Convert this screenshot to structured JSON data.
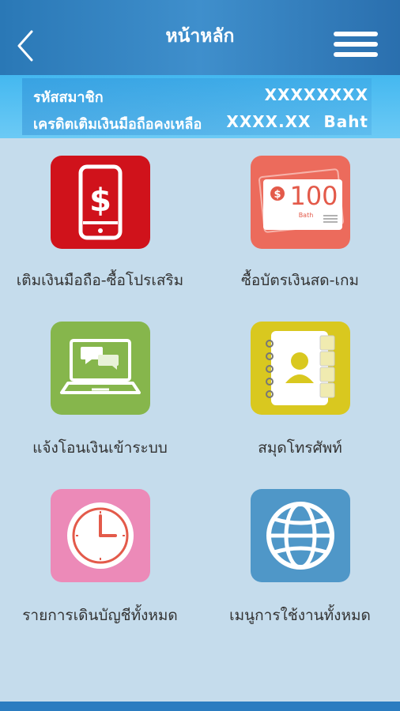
{
  "header": {
    "title": "หน้าหลัก"
  },
  "info": {
    "member_label": "รหัสสมาชิก",
    "member_value": "XXXXXXXX",
    "balance_label": "เครดิตเติมเงินมือถือคงเหลือ",
    "balance_value": "XXXX.XX  Baht"
  },
  "menu": [
    {
      "label": "เติมเงินมือถือ-ซื้อโปรเสริม",
      "icon": "mobile-topup-icon",
      "color": "#d0121b"
    },
    {
      "label": "ซื้อบัตรเงินสด-เกม",
      "icon": "cash-card-icon",
      "color": "#ec6b5c"
    },
    {
      "label": "แจ้งโอนเงินเข้าระบบ",
      "icon": "laptop-chat-icon",
      "color": "#86b64c"
    },
    {
      "label": "สมุดโทรศัพท์",
      "icon": "phonebook-icon",
      "color": "#d9c81f"
    },
    {
      "label": "รายการเดินบัญชีทั้งหมด",
      "icon": "clock-icon",
      "color": "#ec8ab8"
    },
    {
      "label": "เมนูการใช้งานทั้งหมด",
      "icon": "globe-icon",
      "color": "#4f97c8"
    }
  ],
  "cash_card": {
    "amount": "100",
    "currency": "Bath"
  }
}
